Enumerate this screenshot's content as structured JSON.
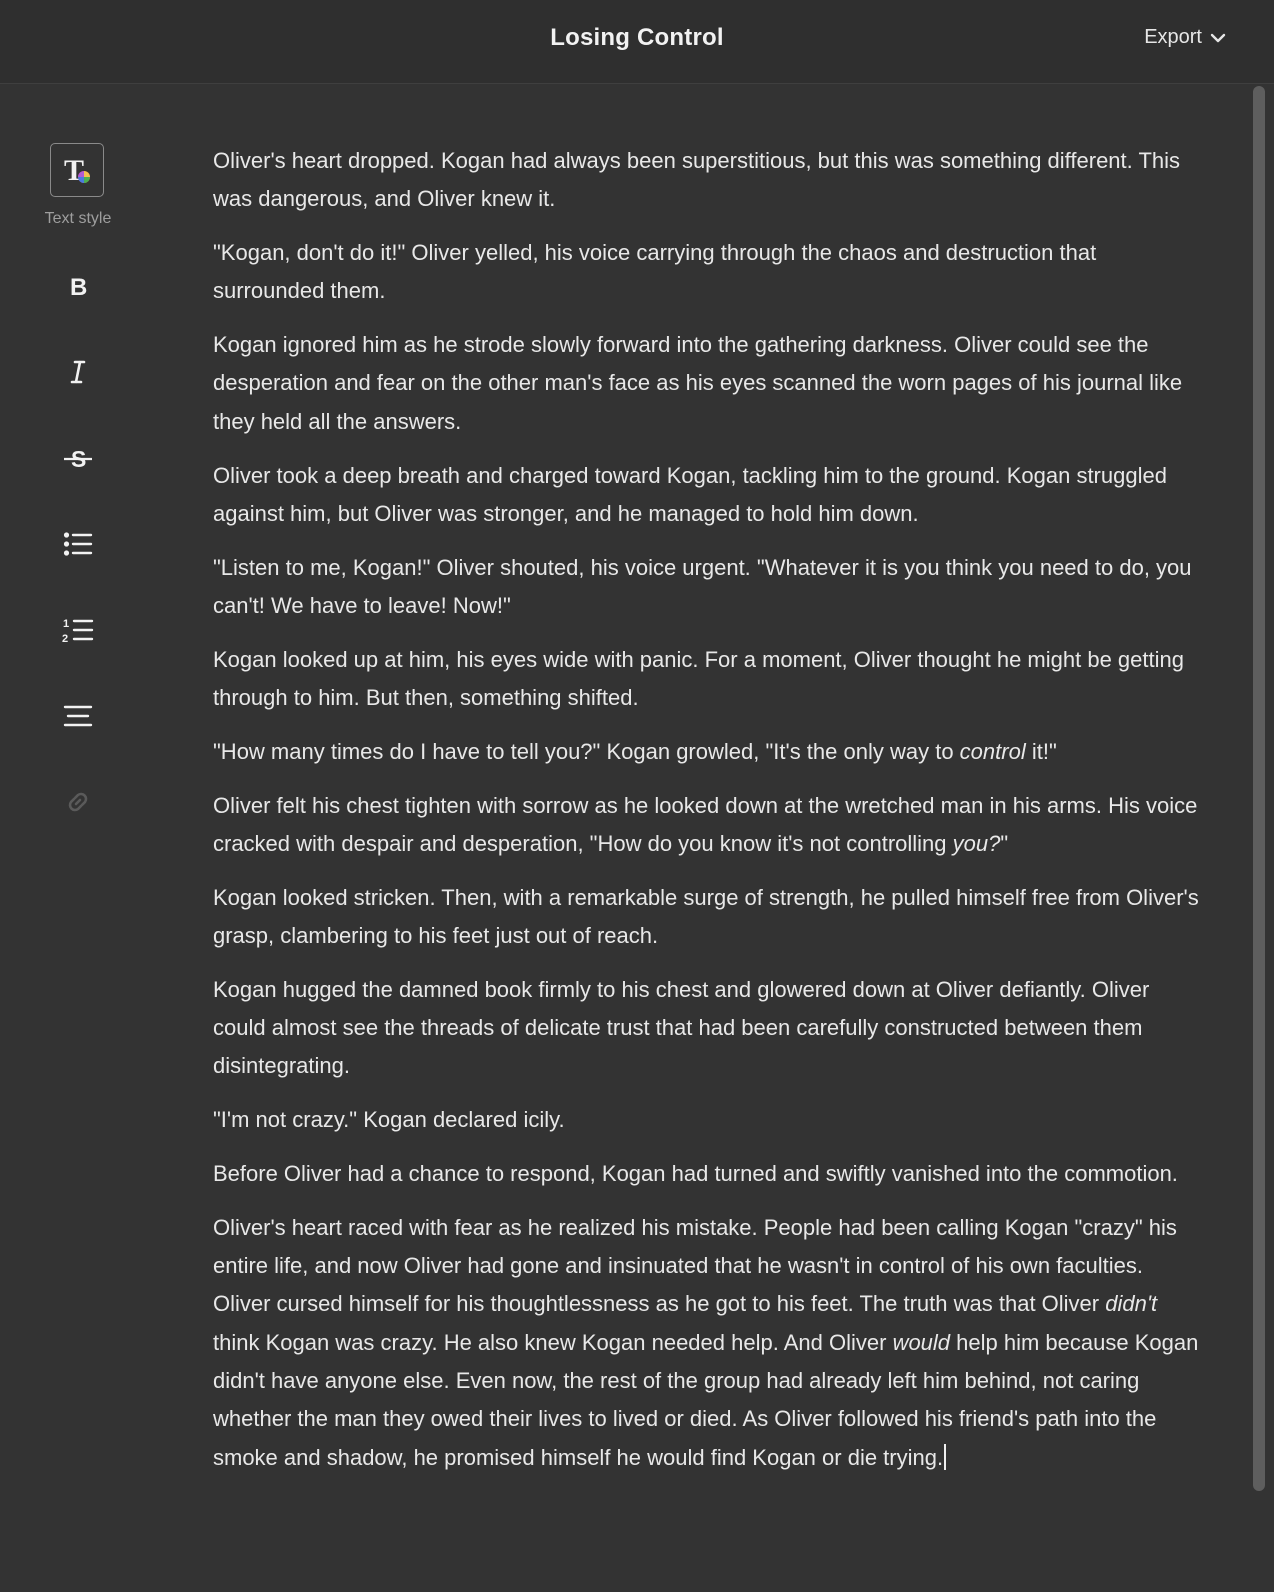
{
  "header": {
    "title": "Losing Control",
    "export_label": "Export"
  },
  "toolbar": {
    "text_style_label": "Text style",
    "tools": [
      {
        "name": "bold",
        "icon": "bold-icon"
      },
      {
        "name": "italic",
        "icon": "italic-icon"
      },
      {
        "name": "strikethrough",
        "icon": "strikethrough-icon"
      },
      {
        "name": "bulleted-list",
        "icon": "bulleted-list-icon"
      },
      {
        "name": "numbered-list",
        "icon": "numbered-list-icon"
      },
      {
        "name": "align",
        "icon": "align-icon"
      },
      {
        "name": "link",
        "icon": "link-icon",
        "disabled": true
      }
    ]
  },
  "document": {
    "paragraphs": [
      [
        {
          "t": "Oliver's heart dropped. Kogan had always been superstitious, but this was something different. This was dangerous, and Oliver knew it."
        }
      ],
      [
        {
          "t": "\"Kogan, don't do it!\" Oliver yelled, his voice carrying through the chaos and destruction that surrounded them."
        }
      ],
      [
        {
          "t": "Kogan ignored him as he strode slowly forward into the gathering darkness. Oliver could see the desperation and fear on the other man's face as his eyes scanned the worn pages of his journal like they held all the answers."
        }
      ],
      [
        {
          "t": "Oliver took a deep breath and charged toward Kogan, tackling him to the ground. Kogan struggled against him, but Oliver was stronger, and he managed to hold him down."
        }
      ],
      [
        {
          "t": "\"Listen to me, Kogan!\" Oliver shouted, his voice urgent. \"Whatever it is you think you need to do, you can't! We have to leave! Now!\""
        }
      ],
      [
        {
          "t": "Kogan looked up at him, his eyes wide with panic. For a moment, Oliver thought he might be getting through to him. But then, something shifted."
        }
      ],
      [
        {
          "t": "\"How many times do I have to tell you?\" Kogan growled, \"It's the only way to "
        },
        {
          "t": "control",
          "i": true
        },
        {
          "t": " it!\""
        }
      ],
      [
        {
          "t": "Oliver felt his chest tighten with sorrow as he looked down at the wretched man in his arms. His voice cracked with despair and desperation, \"How do you know it's not controlling "
        },
        {
          "t": "you?",
          "i": true
        },
        {
          "t": "\""
        }
      ],
      [
        {
          "t": "Kogan looked stricken. Then, with a remarkable surge of strength, he pulled himself free from Oliver's grasp, clambering to his feet just out of reach."
        }
      ],
      [
        {
          "t": "Kogan hugged the damned book firmly to his chest and glowered down at Oliver defiantly. Oliver could almost see the threads of delicate trust that had been carefully constructed between them disintegrating."
        }
      ],
      [
        {
          "t": "\"I'm not crazy.\" Kogan declared icily."
        }
      ],
      [
        {
          "t": "Before Oliver had a chance to respond, Kogan had turned and swiftly vanished into the commotion."
        }
      ],
      [
        {
          "t": "Oliver's heart raced with fear as he realized his mistake. People had been calling Kogan \"crazy\" his entire life, and now Oliver had gone and insinuated that he wasn't in control of his own faculties. Oliver cursed himself for his thoughtlessness as he got to his feet. The truth was that Oliver "
        },
        {
          "t": "didn't",
          "i": true
        },
        {
          "t": " think Kogan was crazy. He also knew Kogan needed help. And Oliver "
        },
        {
          "t": "would",
          "i": true
        },
        {
          "t": " help him because Kogan didn't have anyone else. Even now, the rest of the group had already left him behind, not caring whether the man they owed their lives to lived or died. As Oliver followed his friend's path into the smoke and shadow, he promised himself he would find Kogan or die trying."
        }
      ]
    ]
  },
  "colors": {
    "background": "#333333",
    "header_bg": "#2f2f2f",
    "text": "#e8e8e8",
    "muted": "#9e9e9e"
  }
}
